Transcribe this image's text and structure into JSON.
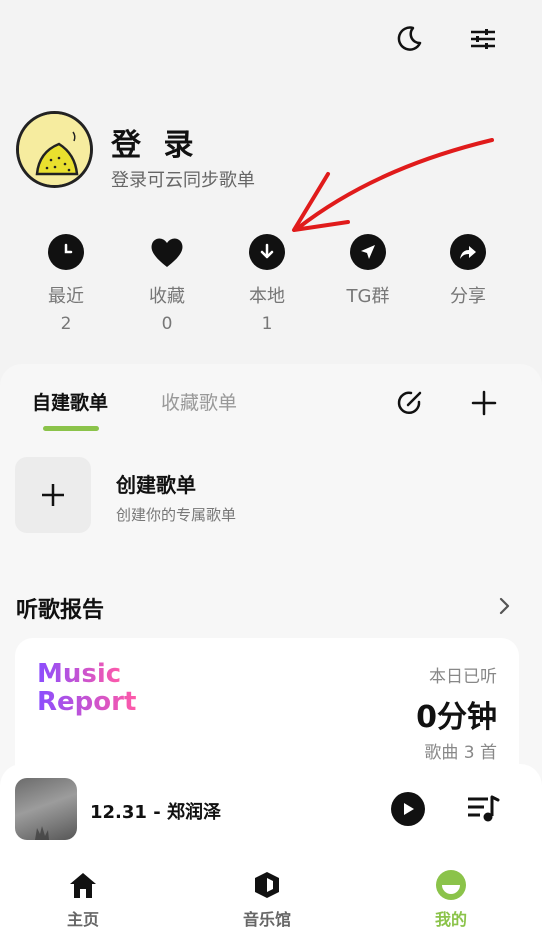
{
  "header": {
    "icons": [
      "moon-icon",
      "sliders-icon"
    ]
  },
  "profile": {
    "title": "登 录",
    "subtitle": "登录可云同步歌单"
  },
  "stats": [
    {
      "label": "最近",
      "count": "2",
      "icon": "clock-icon"
    },
    {
      "label": "收藏",
      "count": "0",
      "icon": "heart-icon"
    },
    {
      "label": "本地",
      "count": "1",
      "icon": "download-icon"
    },
    {
      "label": "TG群",
      "count": "",
      "icon": "telegram-icon"
    },
    {
      "label": "分享",
      "count": "",
      "icon": "share-icon"
    }
  ],
  "tabs": {
    "active": "自建歌单",
    "inactive": "收藏歌单"
  },
  "create": {
    "title": "创建歌单",
    "subtitle": "创建你的专属歌单"
  },
  "report": {
    "section_title": "听歌报告",
    "word1": "Music",
    "word2": "Report",
    "today_label": "本日已听",
    "today_value": "0分钟",
    "songs_text": "歌曲 3 首"
  },
  "player": {
    "song": "12.31 - 郑润泽"
  },
  "nav": {
    "home": "主页",
    "music_hall": "音乐馆",
    "mine": "我的"
  },
  "colors": {
    "accent": "#8bc34a",
    "annotation_arrow": "#e01b1b"
  }
}
